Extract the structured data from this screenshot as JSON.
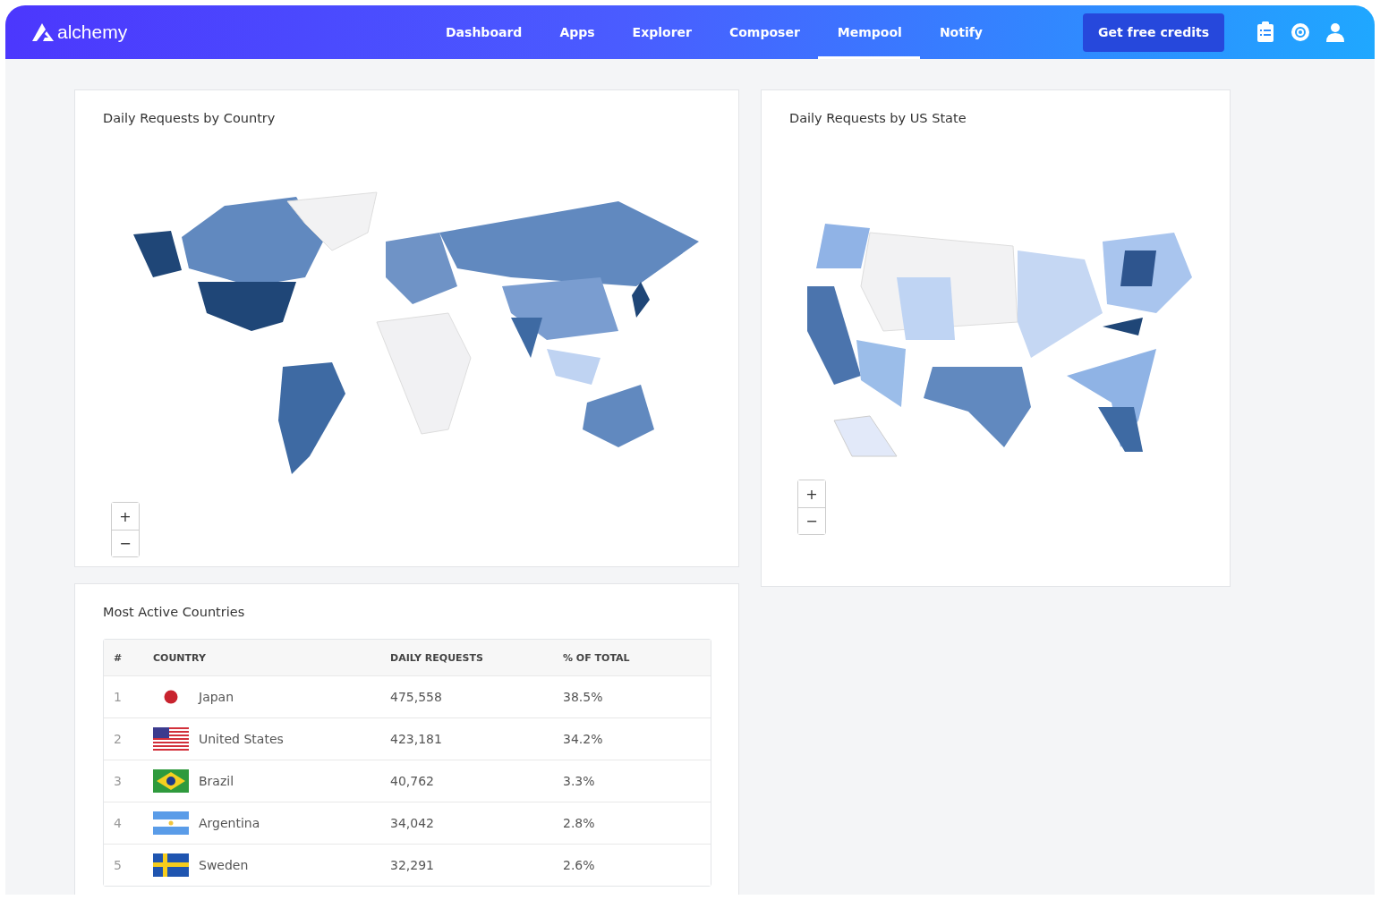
{
  "brand": {
    "name": "alchemy"
  },
  "nav": [
    {
      "label": "Dashboard",
      "selected": false
    },
    {
      "label": "Apps",
      "selected": false
    },
    {
      "label": "Explorer",
      "selected": false
    },
    {
      "label": "Composer",
      "selected": false
    },
    {
      "label": "Mempool",
      "selected": true
    },
    {
      "label": "Notify",
      "selected": false
    }
  ],
  "cta": {
    "label": "Get free credits"
  },
  "world_map": {
    "title": "Daily Requests by Country",
    "zoom_in": "+",
    "zoom_out": "−"
  },
  "state_map": {
    "title": "Daily Requests by US State",
    "zoom_in": "+",
    "zoom_out": "−"
  },
  "table": {
    "title": "Most Active Countries",
    "columns": [
      "#",
      "COUNTRY",
      "DAILY REQUESTS",
      "% OF TOTAL"
    ],
    "rows": [
      {
        "rank": "1",
        "kind": "japan",
        "country": "Japan",
        "requests": "475,558",
        "share": "38.5%"
      },
      {
        "rank": "2",
        "kind": "usa",
        "country": "United States",
        "requests": "423,181",
        "share": "34.2%"
      },
      {
        "rank": "3",
        "kind": "brazil",
        "country": "Brazil",
        "requests": "40,762",
        "share": "3.3%"
      },
      {
        "rank": "4",
        "kind": "argentina",
        "country": "Argentina",
        "requests": "34,042",
        "share": "2.8%"
      },
      {
        "rank": "5",
        "kind": "sweden",
        "country": "Sweden",
        "requests": "32,291",
        "share": "2.6%"
      }
    ]
  }
}
